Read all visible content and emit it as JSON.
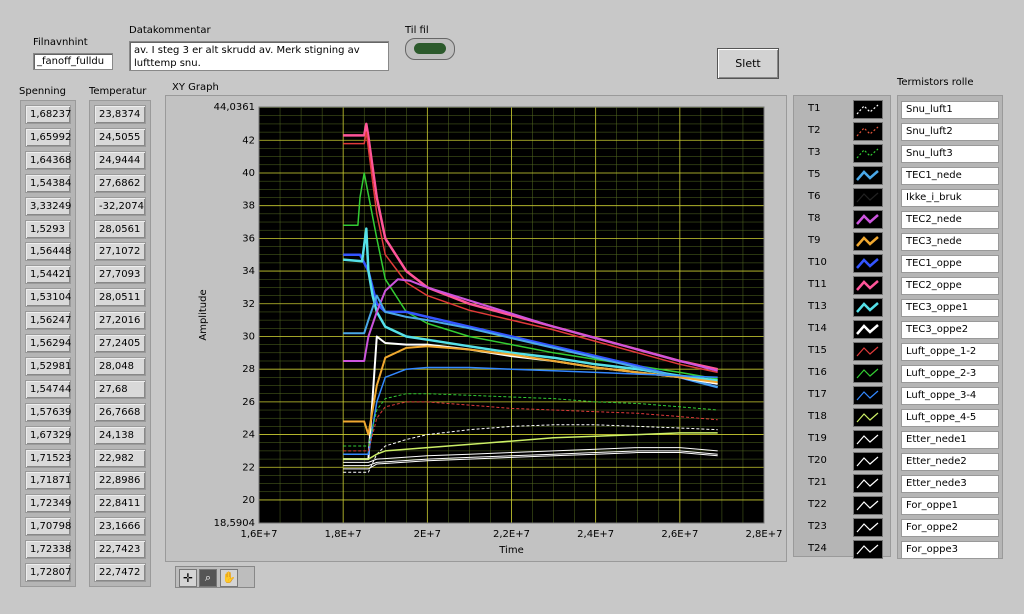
{
  "filnavnhint": {
    "label": "Filnavnhint",
    "value": "_fanoff_fulldu"
  },
  "datakommentar": {
    "label": "Datakommentar",
    "value": "av. I steg 3 er alt skrudd av. Merk stigning av lufttemp snu."
  },
  "til_fil": {
    "label": "Til fil"
  },
  "slett_label": "Slett",
  "spenning": {
    "label": "Spenning",
    "values": [
      "1,68237",
      "1,65992",
      "1,64368",
      "1,54384",
      "3,33249",
      "1,5293",
      "1,56448",
      "1,54421",
      "1,53104",
      "1,56247",
      "1,56294",
      "1,52981",
      "1,54744",
      "1,57639",
      "1,67329",
      "1,71523",
      "1,71871",
      "1,72349",
      "1,70798",
      "1,72338",
      "1,72807"
    ]
  },
  "temperatur": {
    "label": "Temperatur",
    "values": [
      "23,8374",
      "24,5055",
      "24,9444",
      "27,6862",
      "-32,2074",
      "28,0561",
      "27,1072",
      "27,7093",
      "28,0511",
      "27,2016",
      "27,2405",
      "28,048",
      "27,68",
      "26,7668",
      "24,138",
      "22,982",
      "22,8986",
      "22,8411",
      "23,1666",
      "22,7423",
      "22,7472"
    ]
  },
  "graph": {
    "label": "XY Graph",
    "xlabel": "Time",
    "ylabel": "Amplitude"
  },
  "roles_label": "Termistors rolle",
  "legend": [
    {
      "name": "T1",
      "role": "Snu_luft1",
      "color": "#ffffff",
      "style": "dash"
    },
    {
      "name": "T2",
      "role": "Snu_luft2",
      "color": "#e8553a",
      "style": "dash"
    },
    {
      "name": "T3",
      "role": "Snu_luft3",
      "color": "#33cc33",
      "style": "dash"
    },
    {
      "name": "T5",
      "role": "TEC1_nede",
      "color": "#4aa8e8",
      "style": "bold"
    },
    {
      "name": "T6",
      "role": "Ikke_i_bruk",
      "color": "#222222",
      "style": "solid"
    },
    {
      "name": "T8",
      "role": "TEC2_nede",
      "color": "#cc55dd",
      "style": "bold"
    },
    {
      "name": "T9",
      "role": "TEC3_nede",
      "color": "#f0a830",
      "style": "bold"
    },
    {
      "name": "T10",
      "role": "TEC1_oppe",
      "color": "#3355ff",
      "style": "bold"
    },
    {
      "name": "T11",
      "role": "TEC2_oppe",
      "color": "#ff5599",
      "style": "bold"
    },
    {
      "name": "T13",
      "role": "TEC3_oppe1",
      "color": "#55e0e8",
      "style": "bold"
    },
    {
      "name": "T14",
      "role": "TEC3_oppe2",
      "color": "#ffffff",
      "style": "bold"
    },
    {
      "name": "T15",
      "role": "Luft_oppe_1-2",
      "color": "#e03a3a",
      "style": "solid"
    },
    {
      "name": "T16",
      "role": "Luft_oppe_2-3",
      "color": "#33cc33",
      "style": "solid"
    },
    {
      "name": "T17",
      "role": "Luft_oppe_3-4",
      "color": "#3388ff",
      "style": "solid"
    },
    {
      "name": "T18",
      "role": "Luft_oppe_4-5",
      "color": "#ccee66",
      "style": "solid"
    },
    {
      "name": "T19",
      "role": "Etter_nede1",
      "color": "#ffffff",
      "style": "solid"
    },
    {
      "name": "T20",
      "role": "Etter_nede2",
      "color": "#ffffff",
      "style": "solid"
    },
    {
      "name": "T21",
      "role": "Etter_nede3",
      "color": "#ffffff",
      "style": "solid"
    },
    {
      "name": "T22",
      "role": "For_oppe1",
      "color": "#ffffff",
      "style": "solid"
    },
    {
      "name": "T23",
      "role": "For_oppe2",
      "color": "#ffffff",
      "style": "solid"
    },
    {
      "name": "T24",
      "role": "For_oppe3",
      "color": "#ffffff",
      "style": "solid"
    }
  ],
  "chart_data": {
    "type": "line",
    "title": "XY Graph",
    "xlabel": "Time",
    "ylabel": "Amplitude",
    "xlim": [
      16000000,
      28000000
    ],
    "ylim": [
      18.5904,
      44.0361
    ],
    "x_ticks": [
      "1,6E+7",
      "1,8E+7",
      "2E+7",
      "2,2E+7",
      "2,4E+7",
      "2,6E+7",
      "2,8E+7"
    ],
    "y_ticks": [
      "44,0361",
      "42",
      "40",
      "38",
      "36",
      "34",
      "32",
      "30",
      "28",
      "26",
      "24",
      "22",
      "20",
      "18,5904"
    ],
    "y_tick_values": [
      44.0361,
      42,
      40,
      38,
      36,
      34,
      32,
      30,
      28,
      26,
      24,
      22,
      20,
      18.5904
    ],
    "x_tick_values": [
      16000000,
      18000000,
      20000000,
      22000000,
      24000000,
      26000000,
      28000000
    ],
    "grid": true,
    "series": [
      {
        "name": "T11",
        "color": "#ff5599",
        "width": 2.5,
        "x": [
          18000000.0,
          18500000.0,
          18550000.0,
          18600000.0,
          18800000.0,
          19000000.0,
          19500000.0,
          20000000.0,
          21000000.0,
          22000000.0,
          23000000.0,
          24000000.0,
          25000000.0,
          26000000.0,
          26900000.0
        ],
        "y": [
          42.3,
          42.3,
          43.0,
          42.2,
          38.5,
          36.0,
          34.0,
          33.0,
          32.0,
          31.3,
          30.6,
          29.9,
          29.2,
          28.5,
          28.0
        ]
      },
      {
        "name": "T2",
        "color": "#e03a3a",
        "width": 1.5,
        "x": [
          18000000.0,
          18500000.0,
          18550000.0,
          18800000.0,
          19000000.0,
          19500000.0,
          20000000.0,
          21000000.0,
          22000000.0,
          23000000.0,
          24000000.0,
          25000000.0,
          26000000.0,
          26900000.0
        ],
        "y": [
          41.8,
          41.8,
          42.5,
          37.5,
          35.0,
          33.3,
          32.5,
          31.6,
          31.0,
          30.4,
          29.7,
          29.0,
          28.3,
          27.8
        ]
      },
      {
        "name": "T16",
        "color": "#33cc33",
        "width": 1.5,
        "x": [
          18000000.0,
          18350000.0,
          18400000.0,
          18500000.0,
          18800000.0,
          19000000.0,
          19500000.0,
          20000000.0,
          21000000.0,
          22000000.0,
          23000000.0,
          24000000.0,
          25000000.0,
          26000000.0,
          26900000.0
        ],
        "y": [
          36.8,
          36.8,
          38.5,
          40.0,
          36.0,
          33.5,
          31.5,
          30.8,
          30.0,
          29.5,
          29.0,
          28.6,
          28.2,
          27.8,
          27.4
        ]
      },
      {
        "name": "T10",
        "color": "#3355ff",
        "width": 2.5,
        "x": [
          18000000.0,
          18400000.0,
          18600000.0,
          18800000.0,
          19000000.0,
          19500000.0,
          20000000.0,
          21000000.0,
          22000000.0,
          23000000.0,
          24000000.0,
          25000000.0,
          26000000.0,
          26900000.0
        ],
        "y": [
          35.0,
          35.0,
          34.0,
          32.0,
          31.5,
          31.5,
          31.2,
          30.6,
          30.0,
          29.4,
          28.8,
          28.2,
          27.5,
          26.9
        ]
      },
      {
        "name": "T13",
        "color": "#55e0e8",
        "width": 2.5,
        "x": [
          18000000.0,
          18450000.0,
          18550000.0,
          18600000.0,
          18700000.0,
          18800000.0,
          19000000.0,
          19500000.0,
          20000000.0,
          21000000.0,
          22000000.0,
          23000000.0,
          24000000.0,
          25000000.0,
          26000000.0,
          26900000.0
        ],
        "y": [
          34.7,
          34.6,
          36.6,
          34.0,
          32.5,
          31.5,
          30.6,
          30.0,
          29.8,
          29.4,
          29.0,
          28.7,
          28.3,
          28.0,
          27.6,
          27.3
        ]
      },
      {
        "name": "T8",
        "color": "#cc55dd",
        "width": 2,
        "x": [
          18000000.0,
          18500000.0,
          18600000.0,
          18800000.0,
          19000000.0,
          19300000.0,
          19600000.0,
          20000000.0,
          21000000.0,
          22000000.0,
          23000000.0,
          24000000.0,
          25000000.0,
          26000000.0,
          26900000.0
        ],
        "y": [
          28.5,
          28.5,
          30.0,
          31.5,
          32.8,
          33.5,
          33.4,
          33.0,
          32.2,
          31.4,
          30.6,
          29.9,
          29.2,
          28.5,
          27.9
        ]
      },
      {
        "name": "T5",
        "color": "#4aa8e8",
        "width": 2,
        "x": [
          18000000.0,
          18500000.0,
          18600000.0,
          18800000.0,
          19000000.0,
          19500000.0,
          20000000.0,
          21000000.0,
          22000000.0,
          23000000.0,
          24000000.0,
          25000000.0,
          26000000.0,
          26900000.0
        ],
        "y": [
          30.2,
          30.2,
          31.0,
          32.5,
          31.5,
          31.2,
          31.0,
          30.5,
          29.9,
          29.3,
          28.7,
          28.1,
          27.5,
          26.9
        ]
      },
      {
        "name": "T14",
        "color": "#ffffff",
        "width": 2,
        "x": [
          18000000.0,
          18600000.0,
          18800000.0,
          19000000.0,
          19500000.0,
          20000000.0,
          21000000.0,
          22000000.0,
          23000000.0,
          24000000.0,
          25000000.0,
          26000000.0,
          26900000.0
        ],
        "y": [
          22.5,
          22.5,
          30.0,
          29.6,
          29.5,
          29.5,
          29.2,
          28.8,
          28.5,
          28.1,
          27.8,
          27.5,
          27.1
        ]
      },
      {
        "name": "T9",
        "color": "#f0a830",
        "width": 2,
        "x": [
          18000000.0,
          18500000.0,
          18600000.0,
          18800000.0,
          19000000.0,
          19500000.0,
          20000000.0,
          21000000.0,
          22000000.0,
          23000000.0,
          24000000.0,
          25000000.0,
          26000000.0,
          26900000.0
        ],
        "y": [
          24.8,
          24.8,
          24.0,
          27.0,
          28.7,
          29.3,
          29.4,
          29.2,
          28.9,
          28.5,
          28.1,
          27.8,
          27.5,
          27.2
        ]
      },
      {
        "name": "T17",
        "color": "#3388ff",
        "width": 1.5,
        "x": [
          18000000.0,
          18600000.0,
          18800000.0,
          19000000.0,
          19500000.0,
          20000000.0,
          21000000.0,
          22000000.0,
          23000000.0,
          24000000.0,
          25000000.0,
          26000000.0,
          26900000.0
        ],
        "y": [
          22.8,
          22.8,
          26.0,
          27.5,
          28.0,
          28.1,
          28.1,
          28.0,
          27.9,
          27.8,
          27.7,
          27.6,
          27.5
        ]
      },
      {
        "name": "T3",
        "color": "#33cc33",
        "width": 1,
        "dash": "3,2",
        "x": [
          18000000.0,
          18600000.0,
          18800000.0,
          19000000.0,
          19500000.0,
          20000000.0,
          21000000.0,
          22000000.0,
          23000000.0,
          24000000.0,
          25000000.0,
          26000000.0,
          26900000.0
        ],
        "y": [
          23.3,
          23.3,
          25.5,
          26.2,
          26.5,
          26.5,
          26.4,
          26.3,
          26.2,
          26.0,
          25.9,
          25.7,
          25.5
        ]
      },
      {
        "name": "T15",
        "color": "#e03a3a",
        "width": 1,
        "dash": "3,2",
        "x": [
          18000000.0,
          18600000.0,
          18800000.0,
          19000000.0,
          19500000.0,
          20000000.0,
          21000000.0,
          22000000.0,
          23000000.0,
          24000000.0,
          25000000.0,
          26000000.0,
          26900000.0
        ],
        "y": [
          23.0,
          23.0,
          25.0,
          25.7,
          26.0,
          26.0,
          25.8,
          25.6,
          25.5,
          25.4,
          25.3,
          25.1,
          24.9
        ]
      },
      {
        "name": "T1",
        "color": "#ffffff",
        "width": 1,
        "dash": "3,2",
        "x": [
          18000000.0,
          18600000.0,
          18800000.0,
          19000000.0,
          19500000.0,
          20000000.0,
          21000000.0,
          22000000.0,
          23000000.0,
          24000000.0,
          25000000.0,
          26000000.0,
          26900000.0
        ],
        "y": [
          21.7,
          21.7,
          22.8,
          23.3,
          23.7,
          24.0,
          24.3,
          24.5,
          24.6,
          24.6,
          24.5,
          24.4,
          24.3
        ]
      },
      {
        "name": "T18",
        "color": "#ccee66",
        "width": 1.5,
        "x": [
          18000000.0,
          18600000.0,
          18800000.0,
          19000000.0,
          19500000.0,
          20000000.0,
          21000000.0,
          22000000.0,
          23000000.0,
          24000000.0,
          25000000.0,
          26000000.0,
          26900000.0
        ],
        "y": [
          22.5,
          22.5,
          22.8,
          23.0,
          23.1,
          23.2,
          23.4,
          23.6,
          23.8,
          23.9,
          24.0,
          24.1,
          24.1
        ]
      },
      {
        "name": "T19",
        "color": "#ffffff",
        "width": 1,
        "x": [
          18000000.0,
          18600000.0,
          18800000.0,
          20000000.0,
          21000000.0,
          22000000.0,
          23000000.0,
          24000000.0,
          25000000.0,
          26000000.0,
          26900000.0
        ],
        "y": [
          22.3,
          22.3,
          22.5,
          22.7,
          22.8,
          22.9,
          23.0,
          23.1,
          23.2,
          23.2,
          23.0
        ]
      },
      {
        "name": "T20",
        "color": "#ffffff",
        "width": 1,
        "x": [
          18000000.0,
          18600000.0,
          18800000.0,
          20000000.0,
          21000000.0,
          22000000.0,
          23000000.0,
          24000000.0,
          25000000.0,
          26000000.0,
          26900000.0
        ],
        "y": [
          22.1,
          22.1,
          22.3,
          22.5,
          22.6,
          22.7,
          22.8,
          22.9,
          23.0,
          23.0,
          22.8
        ]
      },
      {
        "name": "T22",
        "color": "#ffffff",
        "width": 1,
        "x": [
          18000000.0,
          18600000.0,
          18800000.0,
          20000000.0,
          21000000.0,
          22000000.0,
          23000000.0,
          24000000.0,
          25000000.0,
          26000000.0,
          26900000.0
        ],
        "y": [
          21.9,
          21.9,
          22.2,
          22.4,
          22.5,
          22.6,
          22.7,
          22.8,
          22.9,
          22.9,
          22.7
        ]
      }
    ]
  }
}
